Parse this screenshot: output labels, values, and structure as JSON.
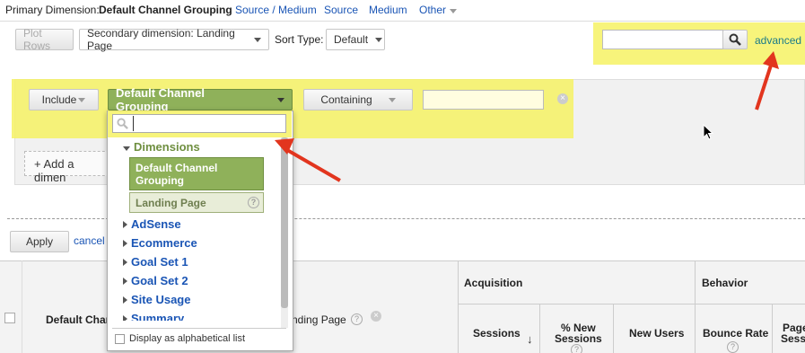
{
  "primary_dimension": {
    "label": "Primary Dimension:",
    "selected": "Default Channel Grouping",
    "options": [
      "Source / Medium",
      "Source",
      "Medium",
      "Other"
    ]
  },
  "toolbar": {
    "plot_rows": "Plot Rows",
    "secondary_dimension": "Secondary dimension: Landing Page",
    "sort_type_label": "Sort Type:",
    "sort_type_value": "Default",
    "search_value": "",
    "advanced_link": "advanced"
  },
  "filter": {
    "include": "Include",
    "dimension": "Default Channel Grouping",
    "match_type": "Containing",
    "value": "",
    "add_dimension": "+ Add a dimen"
  },
  "dropdown": {
    "search_value": "",
    "group_dimensions": "Dimensions",
    "items": [
      "Default Channel Grouping",
      "Landing Page"
    ],
    "groups": [
      "AdSense",
      "Ecommerce",
      "Goal Set 1",
      "Goal Set 2",
      "Site Usage",
      "Summary"
    ],
    "alphabetical_label": "Display as alphabetical list"
  },
  "actions": {
    "apply": "Apply",
    "cancel": "cancel"
  },
  "table": {
    "col_channel": "Default Chann",
    "col_landing": "nding Page",
    "section_acquisition": "Acquisition",
    "section_behavior": "Behavior",
    "col_sessions": "Sessions",
    "col_new_sessions_1": "% New",
    "col_new_sessions_2": "Sessions",
    "col_new_users": "New Users",
    "col_bounce_rate": "Bounce Rate",
    "col_pages_1": "Page",
    "col_pages_2": "Sess"
  },
  "colors": {
    "highlight": "#f6f264",
    "annotation_arrow": "#e2351e",
    "dimension_green": "#8fb15a",
    "link_blue": "#1a55b5"
  }
}
